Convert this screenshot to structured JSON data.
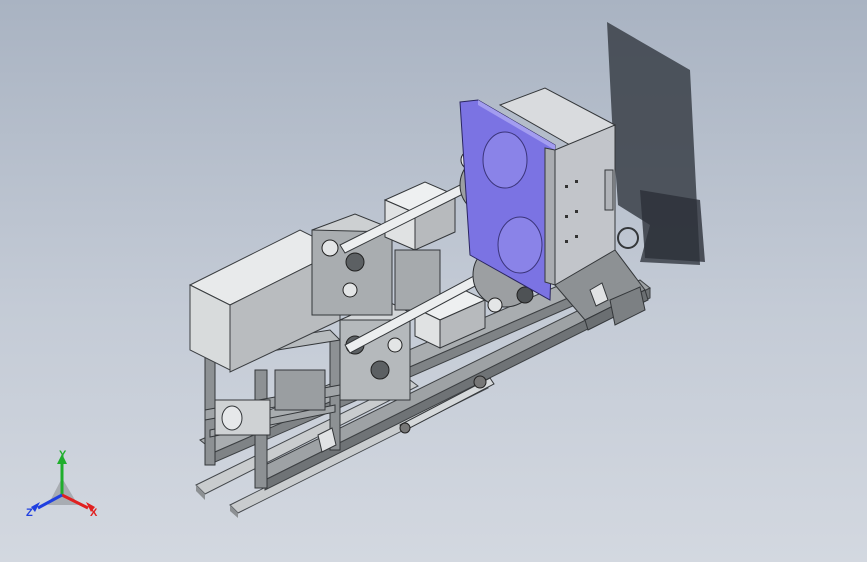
{
  "viewport": {
    "background_top": "#a9b3c2",
    "background_bottom": "#d3d8e0"
  },
  "model": {
    "part_color": "#d6dadd",
    "frame_color": "#7f8386",
    "accent_panel_color": "#7b73e3",
    "cabinet_color": "#c9cbd0",
    "shadow_color": "#3a3f48"
  },
  "triad": {
    "x_label": "X",
    "y_label": "Y",
    "z_label": "Z",
    "x_color": "#e02020",
    "y_color": "#1fae2c",
    "z_color": "#2040e0"
  }
}
